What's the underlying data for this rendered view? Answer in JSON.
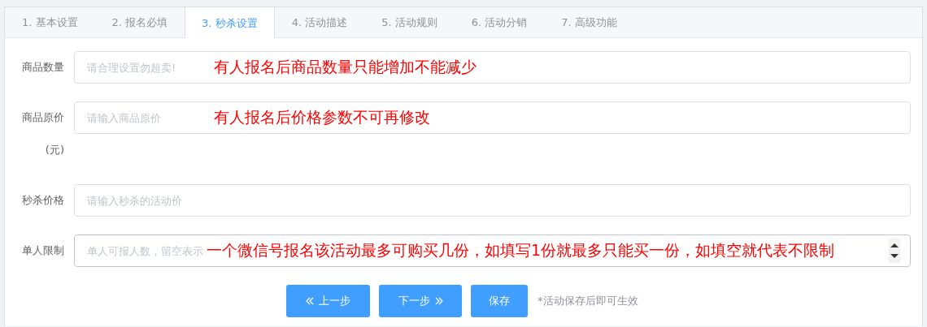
{
  "tabs": [
    {
      "label": "1. 基本设置",
      "selected": false
    },
    {
      "label": "2. 报名必填",
      "selected": false
    },
    {
      "label": "3. 秒杀设置",
      "selected": true
    },
    {
      "label": "4. 活动描述",
      "selected": false
    },
    {
      "label": "5. 活动规则",
      "selected": false
    },
    {
      "label": "6. 活动分销",
      "selected": false
    },
    {
      "label": "7. 高级功能",
      "selected": false
    }
  ],
  "fields": [
    {
      "label": "商品数量",
      "kind": "text",
      "placeholder": "请合理设置勿超卖!",
      "annotation": "有人报名后商品数量只能增加不能减少"
    },
    {
      "label": "商品原价(元)",
      "kind": "text",
      "placeholder": "请输入商品原价",
      "annotation": "有人报名后价格参数不可再修改"
    },
    {
      "label": "秒杀价格",
      "kind": "text",
      "placeholder": "请输入秒杀的活动价"
    },
    {
      "label": "单人限制",
      "kind": "number",
      "placeholder": "单人可报人数，留空表示",
      "annotation": "一个微信号报名该活动最多可购买几份，如填写1份就最多只能买一份，如填空就代表不限制"
    }
  ],
  "buttons": [
    {
      "label": "上一步",
      "kind": "prev"
    },
    {
      "label": "下一步",
      "kind": "next"
    },
    {
      "label": "保存",
      "kind": "plain"
    }
  ],
  "note": "*活动保存后即可生效"
}
